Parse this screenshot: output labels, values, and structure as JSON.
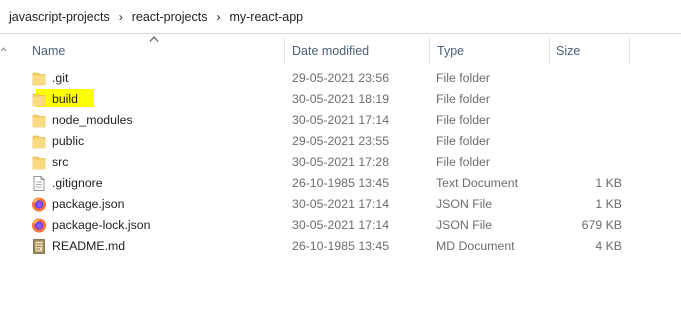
{
  "breadcrumb": {
    "items": [
      "javascript-projects",
      "react-projects",
      "my-react-app"
    ],
    "separator": "›"
  },
  "columns": {
    "name": "Name",
    "date": "Date modified",
    "type": "Type",
    "size": "Size"
  },
  "files": [
    {
      "name": ".git",
      "date": "29-05-2021 23:56",
      "type": "File folder",
      "size": "",
      "icon": "folder-icon",
      "highlighted": false
    },
    {
      "name": "build",
      "date": "30-05-2021 18:19",
      "type": "File folder",
      "size": "",
      "icon": "folder-icon",
      "highlighted": true
    },
    {
      "name": "node_modules",
      "date": "30-05-2021 17:14",
      "type": "File folder",
      "size": "",
      "icon": "folder-icon",
      "highlighted": false
    },
    {
      "name": "public",
      "date": "29-05-2021 23:55",
      "type": "File folder",
      "size": "",
      "icon": "folder-icon",
      "highlighted": false
    },
    {
      "name": "src",
      "date": "30-05-2021 17:28",
      "type": "File folder",
      "size": "",
      "icon": "folder-icon",
      "highlighted": false
    },
    {
      "name": ".gitignore",
      "date": "26-10-1985 13:45",
      "type": "Text Document",
      "size": "1 KB",
      "icon": "text-document-icon",
      "highlighted": false
    },
    {
      "name": "package.json",
      "date": "30-05-2021 17:14",
      "type": "JSON File",
      "size": "1 KB",
      "icon": "firefox-icon",
      "highlighted": false
    },
    {
      "name": "package-lock.json",
      "date": "30-05-2021 17:14",
      "type": "JSON File",
      "size": "679 KB",
      "icon": "firefox-icon",
      "highlighted": false
    },
    {
      "name": "README.md",
      "date": "26-10-1985 13:45",
      "type": "MD Document",
      "size": "4 KB",
      "icon": "md-document-icon",
      "highlighted": false
    }
  ],
  "colors": {
    "highlight": "#ffff00",
    "folder": "#f5cd62",
    "header_text": "#4c607a",
    "secondary_text": "#6d6d6d"
  }
}
